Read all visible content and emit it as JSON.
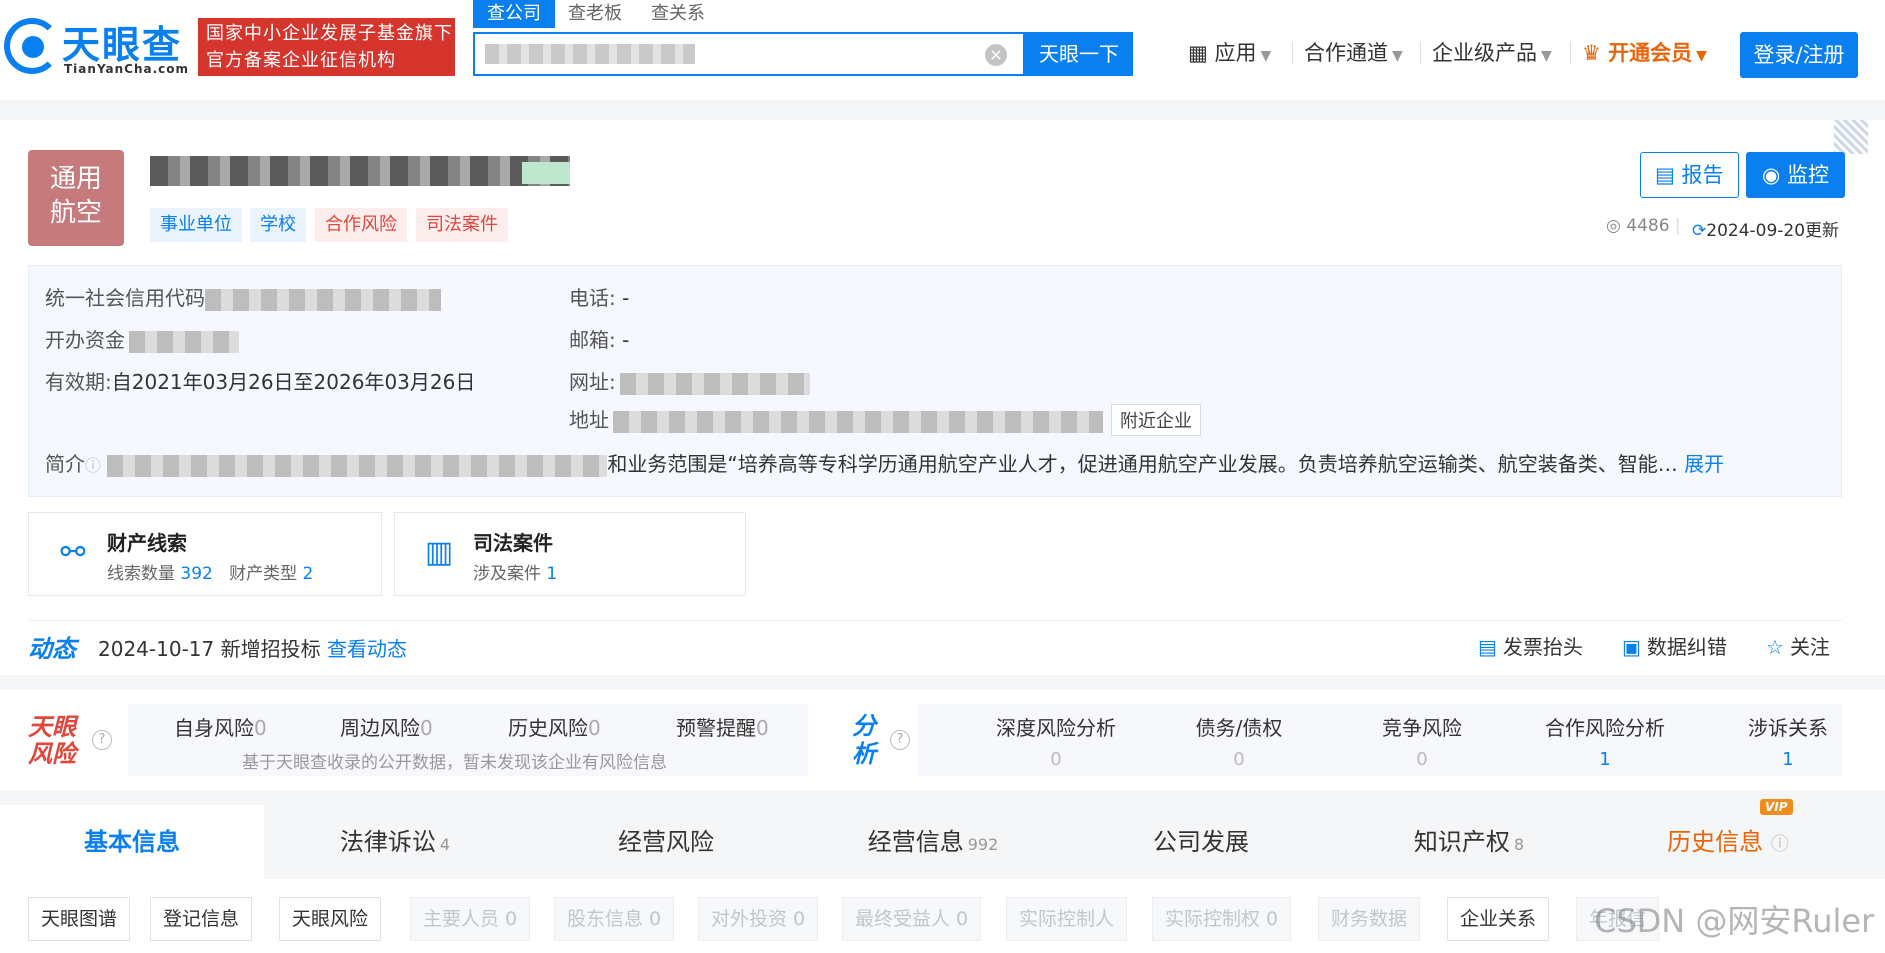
{
  "header": {
    "logo_cn": "天眼查",
    "logo_en": "TianYanCha.com",
    "badge_line1": "国家中小企业发展子基金旗下",
    "badge_line2": "官方备案企业征信机构",
    "search_tabs": [
      "查公司",
      "查老板",
      "查关系"
    ],
    "search_button": "天眼一下",
    "nav": [
      "应用",
      "合作通道",
      "企业级产品",
      "开通会员"
    ],
    "login": "登录/注册"
  },
  "company": {
    "avatar_line1": "通用",
    "avatar_line2": "航空",
    "tags": [
      "事业单位",
      "学校",
      "合作风险",
      "司法案件"
    ],
    "report_button": "报告",
    "monitor_button": "监控",
    "views": "4486",
    "updated": "2024-09-20更新",
    "info": {
      "credit_code_label": "统一社会信用代码",
      "capital_label": "开办资金",
      "validity_label": "有效期:",
      "validity_value": "自2021年03月26日至2026年03月26日",
      "phone_label": "电话:",
      "phone_value": "-",
      "email_label": "邮箱:",
      "email_value": "-",
      "website_label": "网址:",
      "address_label": "地址",
      "nearby": "附近企业",
      "intro_label": "简介",
      "intro_text": "和业务范围是“培养高等专科学历通用航空产业人才，促进通用航空产业发展。负责培养航空运输类、航空装备类、智能…",
      "expand": "展开"
    },
    "clues": [
      {
        "title": "财产线索",
        "label1": "线索数量",
        "value1": "392",
        "label2": "财产类型",
        "value2": "2"
      },
      {
        "title": "司法案件",
        "label1": "涉及案件",
        "value1": "1"
      }
    ],
    "dynamic": {
      "logo": "动态",
      "date": "2024-10-17",
      "text": "新增招投标",
      "link": "查看动态",
      "actions": [
        "发票抬头",
        "数据纠错",
        "关注"
      ]
    }
  },
  "risk": {
    "logo_line1": "天眼",
    "logo_line2": "风险",
    "items": [
      {
        "label": "自身风险",
        "count": "0"
      },
      {
        "label": "周边风险",
        "count": "0"
      },
      {
        "label": "历史风险",
        "count": "0"
      },
      {
        "label": "预警提醒",
        "count": "0"
      }
    ],
    "note": "基于天眼查收录的公开数据，暂未发现该企业有风险信息",
    "analysis_logo_line1": "分",
    "analysis_logo_line2": "析",
    "analysis": [
      {
        "label": "深度风险分析",
        "value": "0"
      },
      {
        "label": "债务/债权",
        "value": "0"
      },
      {
        "label": "竞争风险",
        "value": "0"
      },
      {
        "label": "合作风险分析",
        "value": "1"
      },
      {
        "label": "涉诉关系",
        "value": "1"
      }
    ]
  },
  "tabs": {
    "main": [
      {
        "label": "基本信息",
        "count": ""
      },
      {
        "label": "法律诉讼",
        "count": "4"
      },
      {
        "label": "经营风险",
        "count": ""
      },
      {
        "label": "经营信息",
        "count": "992"
      },
      {
        "label": "公司发展",
        "count": ""
      },
      {
        "label": "知识产权",
        "count": "8"
      },
      {
        "label": "历史信息",
        "count": ""
      }
    ],
    "vip": "VIP",
    "sub": [
      "天眼图谱",
      "登记信息",
      "天眼风险",
      "主要人员 0",
      "股东信息 0",
      "对外投资 0",
      "最终受益人 0",
      "实际控制人",
      "实际控制权 0",
      "财务数据",
      "企业关系",
      "年报信"
    ]
  },
  "watermark": "CSDN @网安Ruler",
  "colors": {
    "brand": "#0a7ff0",
    "risk": "#e0463c",
    "vip": "#e8650a"
  }
}
